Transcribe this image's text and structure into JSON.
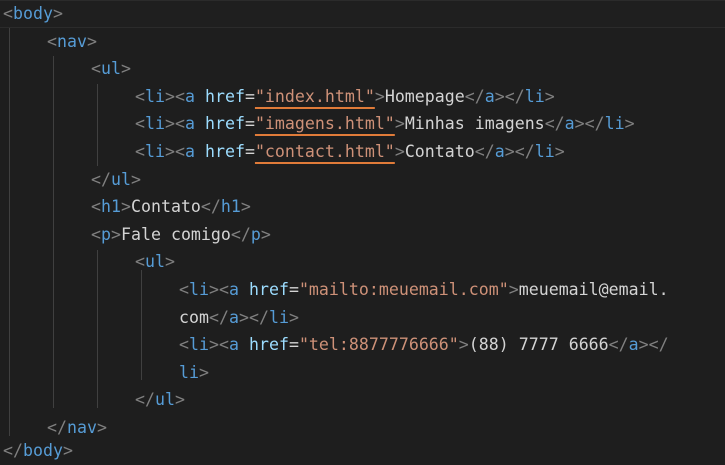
{
  "editor": {
    "theme": {
      "background": "#1e1e1e",
      "tag_color": "#569cd6",
      "bracket_color": "#808080",
      "attr_color": "#9cdcfe",
      "string_color": "#ce9178",
      "text_color": "#d4d4d4"
    },
    "lines": {
      "l1": "<body>",
      "l2": "<nav>",
      "l3": "<ul>",
      "l4": {
        "href": "\"index.html\"",
        "text": "Homepage"
      },
      "l5": {
        "href": "\"imagens.html\"",
        "text": "Minhas imagens"
      },
      "l6": {
        "href": "\"contact.html\"",
        "text": "Contato"
      },
      "l7": "</ul>",
      "l8": {
        "open": "h1",
        "text": "Contato",
        "close": "h1"
      },
      "l9": {
        "open": "p",
        "text": "Fale comigo",
        "close": "p"
      },
      "l10": "<ul>",
      "l11": {
        "href": "\"mailto:meuemail.com\"",
        "text": "meuemail@email."
      },
      "l12": {
        "text": "com"
      },
      "l13": {
        "href": "\"tel:8877776666\"",
        "text": "(88) 7777 6666"
      },
      "l14": {
        "text": "li"
      },
      "l15": "</ul>",
      "l16": "</nav>",
      "l17": "</body>"
    },
    "tokens": {
      "li": "li",
      "a": "a",
      "ul": "ul",
      "nav": "nav",
      "body": "body",
      "href": "href"
    }
  }
}
